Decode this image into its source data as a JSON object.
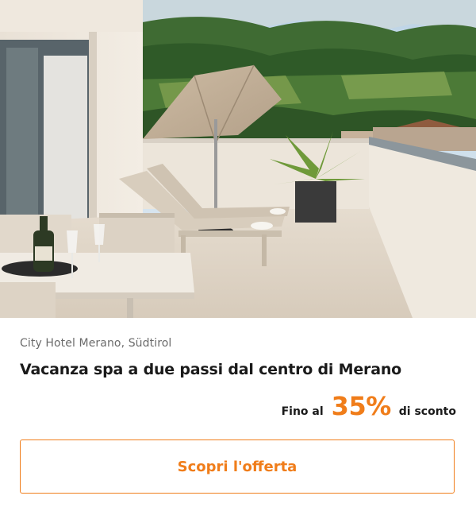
{
  "offer": {
    "location": "City Hotel Merano, Südtirol",
    "title": "Vacanza spa a due passi dal centro di Merano",
    "discount": {
      "prefix": "Fino al",
      "value": "35%",
      "suffix": "di sconto"
    },
    "cta_label": "Scopri l'offerta",
    "accent_color": "#f07d1a"
  }
}
